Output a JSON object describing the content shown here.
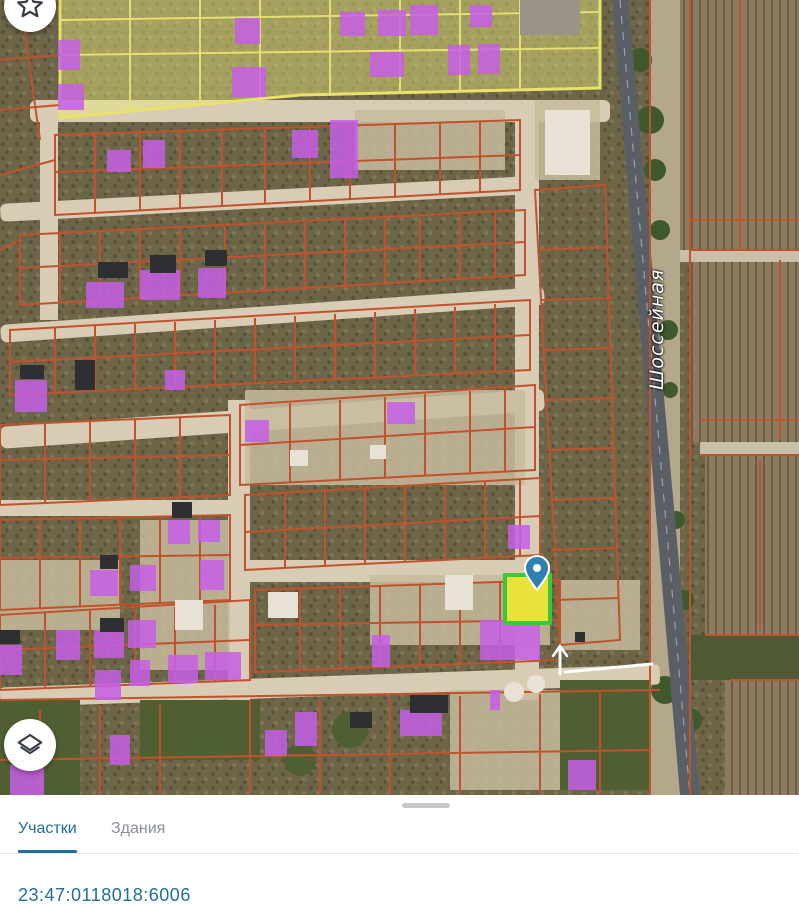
{
  "map": {
    "street_label": "Шоссейная",
    "colors": {
      "parcel_border": "#c0532d",
      "building": "#c65fe8",
      "selected_parcel": "#e8e23a",
      "selected_border": "#3bc63b",
      "highlight_zone": "#e8e87a",
      "road": "#d8ccb4",
      "highway": "#5a5f66",
      "marker": "#2f7fb0"
    },
    "icons": {
      "favorite": "star-icon",
      "layers": "layers-icon",
      "marker": "map-pin-icon"
    }
  },
  "sheet": {
    "tabs": [
      {
        "label": "Участки",
        "active": true
      },
      {
        "label": "Здания",
        "active": false
      }
    ],
    "cadastral_number": "23:47:0118018:6006"
  }
}
